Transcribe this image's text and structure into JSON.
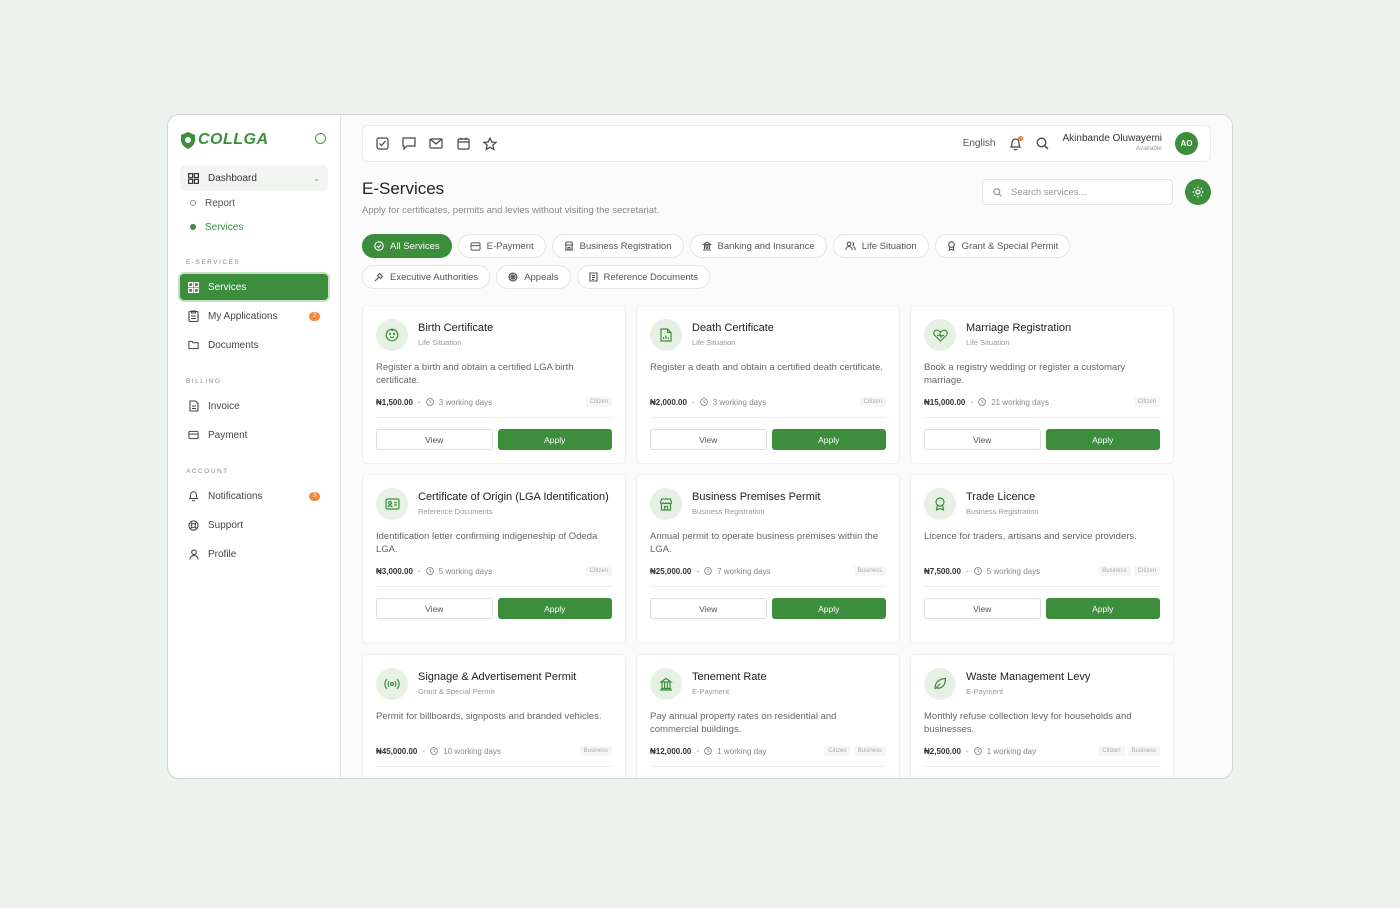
{
  "brand": {
    "name": "COLLGA"
  },
  "sidebar": {
    "dashboard_label": "Dashboard",
    "sub_items": [
      {
        "label": "Report",
        "active": false
      },
      {
        "label": "Services",
        "active": true
      }
    ],
    "sections": [
      {
        "title": "E-SERVICES",
        "items": [
          {
            "label": "Services",
            "icon": "grid-icon",
            "active": true,
            "badge": ""
          },
          {
            "label": "My Applications",
            "icon": "clipboard-icon",
            "active": false,
            "badge": "2"
          },
          {
            "label": "Documents",
            "icon": "folder-icon",
            "active": false,
            "badge": ""
          }
        ]
      },
      {
        "title": "BILLING",
        "items": [
          {
            "label": "Invoice",
            "icon": "file-icon",
            "active": false,
            "badge": ""
          },
          {
            "label": "Payment",
            "icon": "card-icon",
            "active": false,
            "badge": ""
          }
        ]
      },
      {
        "title": "ACCOUNT",
        "items": [
          {
            "label": "Notifications",
            "icon": "bell-icon",
            "active": false,
            "badge": "3"
          },
          {
            "label": "Support",
            "icon": "lifebuoy-icon",
            "active": false,
            "badge": ""
          },
          {
            "label": "Profile",
            "icon": "user-icon",
            "active": false,
            "badge": ""
          }
        ]
      }
    ]
  },
  "topbar": {
    "language": "English",
    "user_name": "Akinbande Oluwayemi",
    "user_status": "Available",
    "avatar_initials": "AO"
  },
  "page": {
    "title": "E-Services",
    "subtitle": "Apply for certificates, permits and levies without visiting the secretariat.",
    "search_placeholder": "Search services..."
  },
  "chips": [
    {
      "label": "All Services",
      "active": true
    },
    {
      "label": "E-Payment",
      "active": false
    },
    {
      "label": "Business Registration",
      "active": false
    },
    {
      "label": "Banking and Insurance",
      "active": false
    },
    {
      "label": "Life Situation",
      "active": false
    },
    {
      "label": "Grant & Special Permit",
      "active": false
    },
    {
      "label": "Executive Authorities",
      "active": false
    },
    {
      "label": "Appeals",
      "active": false
    },
    {
      "label": "Reference Documents",
      "active": false
    }
  ],
  "card_labels": {
    "view": "View",
    "apply": "Apply"
  },
  "services": [
    {
      "title": "Birth Certificate",
      "category": "Life Situation",
      "description": "Register a birth and obtain a certified LGA birth certificate.",
      "price": "₦1,500.00",
      "duration": "3 working days",
      "tags": [
        "Citizen"
      ],
      "icon": "baby-icon"
    },
    {
      "title": "Death Certificate",
      "category": "Life Situation",
      "description": "Register a death and obtain a certified death certificate.",
      "price": "₦2,000.00",
      "duration": "3 working days",
      "tags": [
        "Citizen"
      ],
      "icon": "document-icon"
    },
    {
      "title": "Marriage Registration",
      "category": "Life Situation",
      "description": "Book a registry wedding or register a customary marriage.",
      "price": "₦15,000.00",
      "duration": "21 working days",
      "tags": [
        "Citizen"
      ],
      "icon": "heart-icon"
    },
    {
      "title": "Certificate of Origin (LGA Identification)",
      "category": "Reference Documents",
      "description": "Identification letter confirming indigeneship of Odeda LGA.",
      "price": "₦3,000.00",
      "duration": "5 working days",
      "tags": [
        "Citizen"
      ],
      "icon": "id-card-icon"
    },
    {
      "title": "Business Premises Permit",
      "category": "Business Registration",
      "description": "Annual permit to operate business premises within the LGA.",
      "price": "₦25,000.00",
      "duration": "7 working days",
      "tags": [
        "Business"
      ],
      "icon": "store-icon"
    },
    {
      "title": "Trade Licence",
      "category": "Business Registration",
      "description": "Licence for traders, artisans and service providers.",
      "price": "₦7,500.00",
      "duration": "5 working days",
      "tags": [
        "Business",
        "Citizen"
      ],
      "icon": "award-icon"
    },
    {
      "title": "Signage & Advertisement Permit",
      "category": "Grant & Special Permit",
      "description": "Permit for billboards, signposts and branded vehicles.",
      "price": "₦45,000.00",
      "duration": "10 working days",
      "tags": [
        "Business"
      ],
      "icon": "broadcast-icon"
    },
    {
      "title": "Tenement Rate",
      "category": "E-Payment",
      "description": "Pay annual property rates on residential and commercial buildings.",
      "price": "₦12,000.00",
      "duration": "1 working day",
      "tags": [
        "Citizen",
        "Business"
      ],
      "icon": "building-icon"
    },
    {
      "title": "Waste Management Levy",
      "category": "E-Payment",
      "description": "Monthly refuse collection levy for households and businesses.",
      "price": "₦2,500.00",
      "duration": "1 working day",
      "tags": [
        "Citizen",
        "Business"
      ],
      "icon": "leaf-icon"
    }
  ],
  "colors": {
    "brand_green": "#3c8d3c",
    "badge_orange": "#f08a3a"
  }
}
